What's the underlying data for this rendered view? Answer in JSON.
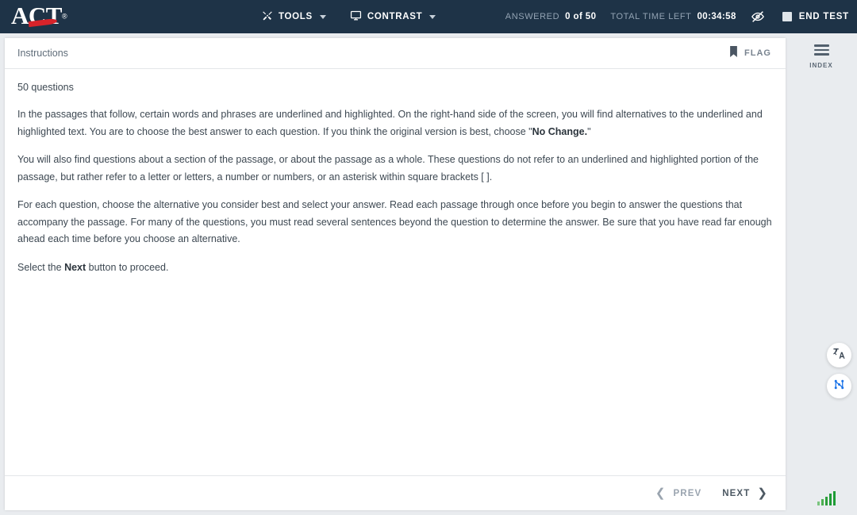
{
  "header": {
    "logo_text": "ACT",
    "logo_registered": "®",
    "menus": [
      {
        "label": "TOOLS",
        "icon": "tools-icon"
      },
      {
        "label": "CONTRAST",
        "icon": "monitor-icon"
      }
    ],
    "answered_label": "ANSWERED",
    "answered_value": "0 of 50",
    "time_label": "TOTAL TIME LEFT",
    "time_value": "00:34:58",
    "hide_icon": "eye-slash-icon",
    "end_test_label": "END TEST",
    "background_color": "#1e3347",
    "accent_color": "#d8232a"
  },
  "sidebar": {
    "index_label": "INDEX",
    "float_buttons": [
      {
        "name": "translate-icon"
      },
      {
        "name": "network-nodes-icon",
        "color": "#1a73e8"
      }
    ],
    "signal_icon": "signal-strength-icon",
    "signal_color": "#1f9c36"
  },
  "panel": {
    "title": "Instructions",
    "flag_label": "FLAG",
    "question_count": "50 questions",
    "paragraphs": [
      "In the passages that follow, certain words and phrases are underlined and highlighted. On the right-hand side of the screen, you will find alternatives to the underlined and highlighted text. You are to choose the best answer to each question. If you think the original version is best, choose \"No Change.\"",
      "You will also find questions about a section of the passage, or about the passage as a whole. These questions do not refer to an underlined and highlighted portion of the passage, but rather refer to a letter or letters, a number or numbers, or an asterisk within square brackets [ ].",
      "For each question, choose the alternative you consider best and select your answer. Read each passage through once before you begin to answer the questions that accompany the passage. For many of the questions, you must read several sentences beyond the question to determine the answer. Be sure that you have read far enough ahead each time before you choose an alternative.",
      "Select the Next button to proceed."
    ],
    "paragraph1_bold": "No Change.",
    "paragraph4_bold": "Next",
    "prev_label": "PREV",
    "next_label": "NEXT"
  }
}
